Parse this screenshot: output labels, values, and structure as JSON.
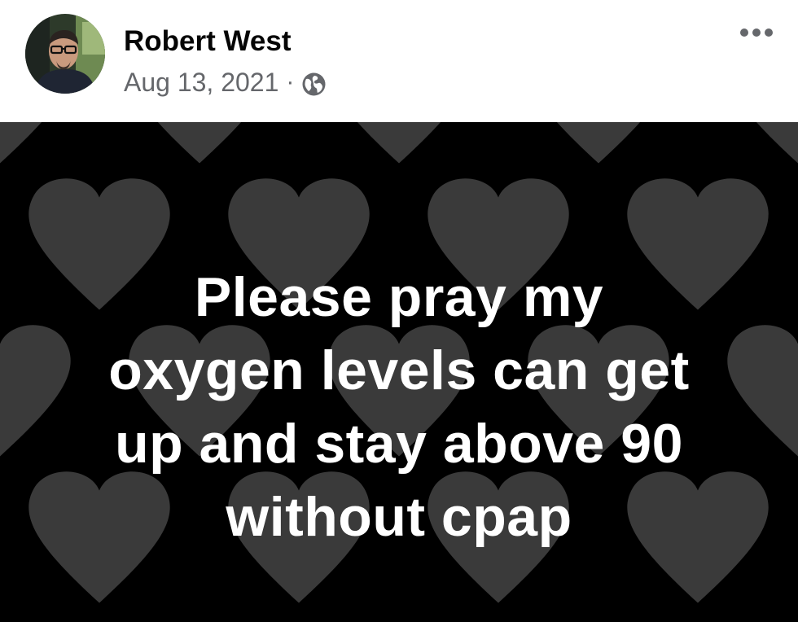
{
  "post": {
    "author": "Robert West",
    "date": "Aug 13, 2021",
    "separator": "·",
    "audience_icon": "globe-icon",
    "more_icon": "more-options-icon",
    "message_lines": [
      "Please pray my",
      "oxygen levels can get",
      "up and stay above 90",
      "without cpap"
    ],
    "background": {
      "pattern": "hearts",
      "base_color": "#000000",
      "heart_color": "#3a3a3a"
    }
  },
  "colors": {
    "name_text": "#050505",
    "meta_text": "#65676b",
    "message_text": "#ffffff"
  }
}
